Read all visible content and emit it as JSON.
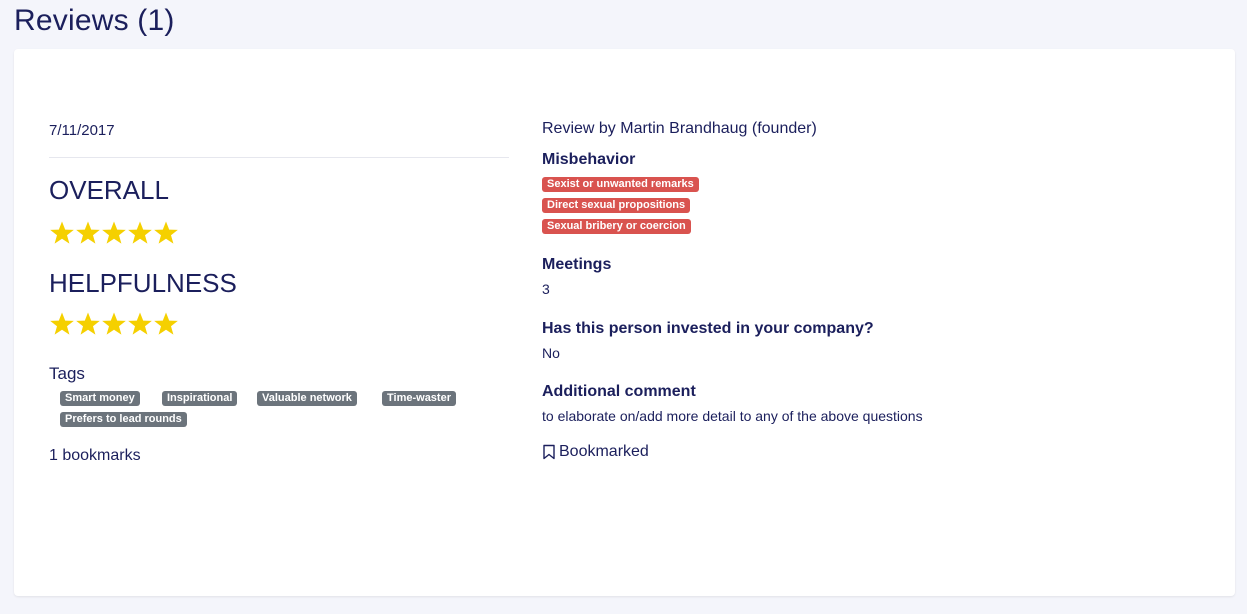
{
  "page": {
    "title": "Reviews (1)"
  },
  "review": {
    "date": "7/11/2017",
    "ratings": [
      {
        "label": "OVERALL",
        "stars": 5,
        "max": 5
      },
      {
        "label": "HELPFULNESS",
        "stars": 5,
        "max": 5
      }
    ],
    "tags_label": "Tags",
    "tags": [
      "Smart money",
      "Inspirational",
      "Valuable network",
      "Time-waster",
      "Prefers to lead rounds"
    ],
    "bookmarks_text": "1 bookmarks",
    "byline": "Review by Martin Brandhaug (founder)",
    "misbehavior_label": "Misbehavior",
    "misbehavior": [
      "Sexist or unwanted remarks",
      "Direct sexual propositions",
      "Sexual bribery or coercion"
    ],
    "meetings_label": "Meetings",
    "meetings_value": "3",
    "invested_label": "Has this person invested in your company?",
    "invested_value": "No",
    "comment_label": "Additional comment",
    "comment_value": "to elaborate on/add more detail to any of the above questions",
    "bookmarked_label": "Bookmarked"
  },
  "colors": {
    "text": "#1b1f5c",
    "star": "#f5d000",
    "tag_bg": "#6c747c",
    "badge_bg": "#d9534f",
    "page_bg": "#f4f5fb"
  }
}
